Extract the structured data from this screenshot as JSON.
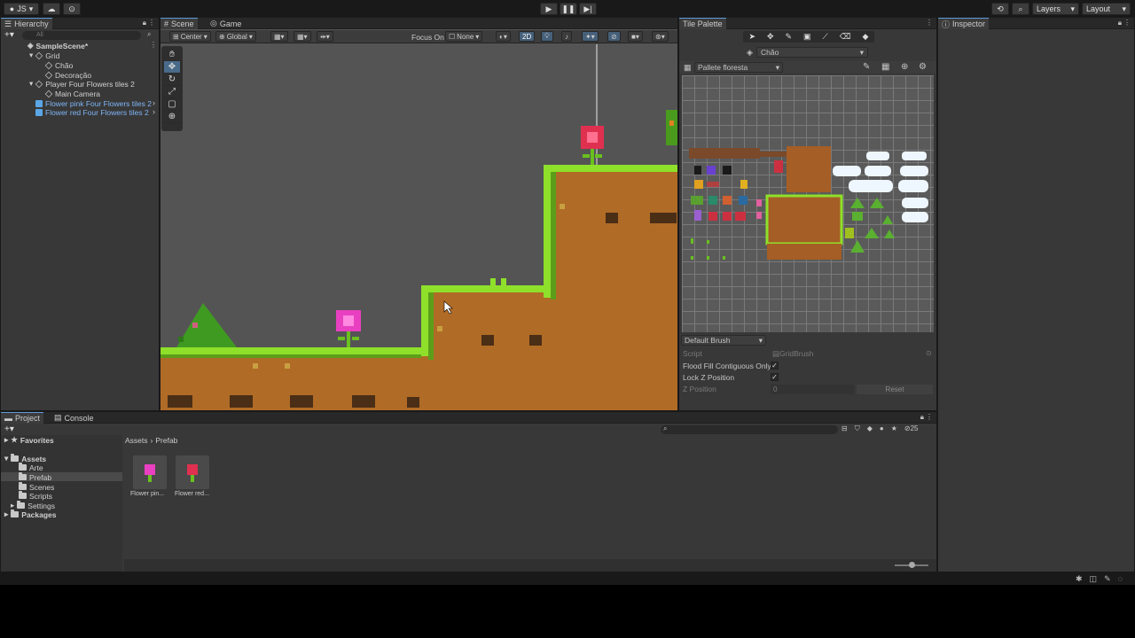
{
  "topbar": {
    "account": "JS",
    "layers_label": "Layers",
    "layout_label": "Layout"
  },
  "hierarchy": {
    "tab_label": "Hierarchy",
    "search_placeholder": "All",
    "items": [
      {
        "label": "SampleScene*"
      },
      {
        "label": "Grid"
      },
      {
        "label": "Chão"
      },
      {
        "label": "Decoração"
      },
      {
        "label": "Player Four Flowers tiles 2"
      },
      {
        "label": "Main Camera"
      },
      {
        "label": "Flower pink Four Flowers tiles 2"
      },
      {
        "label": "Flower red Four Flowers tiles 2"
      }
    ]
  },
  "scene": {
    "tabs": [
      "Scene",
      "Game"
    ],
    "pivot": "Center",
    "space": "Global",
    "focus_on_label": "Focus On",
    "focus_on_value": "None",
    "mode_2d": "2D"
  },
  "tile_palette": {
    "tab_label": "Tile Palette",
    "target": "Chão",
    "palette_name": "Pallete floresta",
    "brush": "Default Brush",
    "props": {
      "script_label": "Script",
      "script_value": "GridBrush",
      "flood_fill_label": "Flood Fill Contiguous Only",
      "lock_z_label": "Lock Z Position",
      "z_position_label": "Z Position",
      "z_position_value": "0",
      "reset_label": "Reset"
    }
  },
  "inspector": {
    "tab_label": "Inspector"
  },
  "project": {
    "tabs": [
      "Project",
      "Console"
    ],
    "favorites": "Favorites",
    "assets_root": "Assets",
    "folders": [
      "Arte",
      "Prefab",
      "Scenes",
      "Scripts",
      "Settings"
    ],
    "packages": "Packages",
    "breadcrumb": [
      "Assets",
      "Prefab"
    ],
    "assets": [
      {
        "label": "Flower pin..."
      },
      {
        "label": "Flower red..."
      }
    ],
    "hidden_count": "25"
  },
  "colors": {
    "selection_blue": "#5e9bd8",
    "prefab_blue": "#7fb5f5",
    "grass": "#8ee02a",
    "dirt": "#b06b26"
  }
}
